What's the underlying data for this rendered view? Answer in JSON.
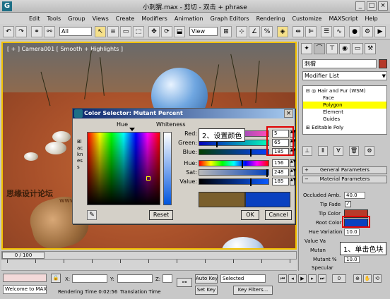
{
  "window": {
    "title": "小刺猬.max - 剪切 - 双击 + phrase",
    "logo": "3ds-max-logo"
  },
  "menu": [
    "Edit",
    "Tools",
    "Group",
    "Views",
    "Create",
    "Modifiers",
    "Animation",
    "Graph Editors",
    "Rendering",
    "Customize",
    "MAXScript",
    "Help"
  ],
  "toolbar": {
    "selection_filter": "All",
    "ref_coord": "View"
  },
  "viewport": {
    "label": "[ + ] Camera001 [ Smooth + Highlights ]"
  },
  "watermark": {
    "main": "思缘设计论坛",
    "url": "www.MISSYUAN.COM"
  },
  "color_selector": {
    "title": "Color Selector: Mutant Percent",
    "hue_label": "Hue",
    "whiteness_label": "Whiteness",
    "blackness_label": "Blackness",
    "reset_label": "Reset",
    "ok_label": "OK",
    "cancel_label": "Cancel",
    "red": {
      "label": "Red:",
      "value": "5"
    },
    "green": {
      "label": "Green:",
      "value": "65"
    },
    "blue": {
      "label": "Blue:",
      "value": "185"
    },
    "hue": {
      "label": "Hue:",
      "value": "156"
    },
    "sat": {
      "label": "Sat:",
      "value": "248"
    },
    "val": {
      "label": "Value:",
      "value": "185"
    },
    "old_color": "#7a5f2c",
    "new_color": "#0a41c0"
  },
  "annotations": {
    "step2": "2、设置颜色",
    "step1": "1、单击色块"
  },
  "command_panel": {
    "object_name": "刺猬",
    "modifier_list": "Modifier List",
    "stack": [
      {
        "label": "Hair and Fur (WSM)",
        "selected": false
      },
      {
        "label": "Face",
        "selected": false
      },
      {
        "label": "Polygon",
        "selected": true
      },
      {
        "label": "Element",
        "selected": false
      },
      {
        "label": "Guides",
        "selected": false
      },
      {
        "label": "Editable Poly",
        "selected": false
      }
    ],
    "rollouts": {
      "general": "General Parameters",
      "material": "Material Parameters"
    },
    "params": {
      "occluded_amb_label": "Occluded Amb.",
      "occluded_amb_value": "40.0",
      "tip_fade_label": "Tip Fade",
      "tip_fade_checked": "✓",
      "tip_color_label": "Tip Color",
      "root_color_label": "Root Color",
      "hue_variation_label": "Hue Variation",
      "hue_variation_value": "10.0",
      "value_variation_label": "Value Va",
      "mutant_color_label": "Mutan",
      "mutant_pct_label": "Mutant %",
      "mutant_pct_value": "10.0",
      "specular_label": "Specular",
      "tip_color": "#b83a2a",
      "root_color": "#0a41c0"
    }
  },
  "timeline": {
    "slider": "0 / 100",
    "ticks": [
      "0",
      "10",
      "20",
      "30",
      "40",
      "50",
      "60",
      "70",
      "80",
      "90",
      "100"
    ]
  },
  "status": {
    "welcome": "Welcome to MAX",
    "rendering_time": "Rendering Time  0:02:56",
    "translation_time": "Translation Time",
    "x_label": "X:",
    "y_label": "Y:",
    "z_label": "Z:",
    "auto_key": "Auto Key",
    "set_key": "Set Key",
    "key_mode": "Selected",
    "key_filters": "Key Filters..."
  }
}
